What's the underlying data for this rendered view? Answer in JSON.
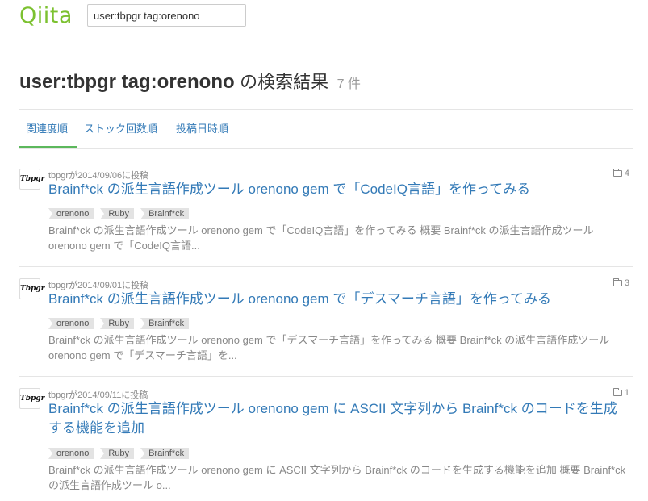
{
  "header": {
    "logo": "Qiita",
    "search_value": "user:tbpgr tag:orenono"
  },
  "results": {
    "query": "user:tbpgr tag:orenono",
    "suffix": "の検索結果",
    "count": "7 件"
  },
  "tabs": [
    {
      "label": "関連度順",
      "active": true
    },
    {
      "label": "ストック回数順",
      "active": false
    },
    {
      "label": "投稿日時順",
      "active": false
    }
  ],
  "items": [
    {
      "avatar": "Tbpgr",
      "meta": "tbpgrが2014/09/06に投稿",
      "stock": "4",
      "title": "Brainf*ck の派生言語作成ツール orenono gem で「CodeIQ言語」を作ってみる",
      "tags": [
        "orenono",
        "Ruby",
        "Brainf*ck"
      ],
      "snippet": "Brainf*ck の派生言語作成ツール orenono gem で「CodeIQ言語」を作ってみる 概要 Brainf*ck の派生言語作成ツール orenono gem で「CodeIQ言語..."
    },
    {
      "avatar": "Tbpgr",
      "meta": "tbpgrが2014/09/01に投稿",
      "stock": "3",
      "title": "Brainf*ck の派生言語作成ツール orenono gem で「デスマーチ言語」を作ってみる",
      "tags": [
        "orenono",
        "Ruby",
        "Brainf*ck"
      ],
      "snippet": "Brainf*ck の派生言語作成ツール orenono gem で「デスマーチ言語」を作ってみる 概要 Brainf*ck の派生言語作成ツール orenono gem で「デスマーチ言語」を..."
    },
    {
      "avatar": "Tbpgr",
      "meta": "tbpgrが2014/09/11に投稿",
      "stock": "1",
      "title": "Brainf*ck の派生言語作成ツール orenono gem に ASCII 文字列から Brainf*ck のコードを生成する機能を追加",
      "tags": [
        "orenono",
        "Ruby",
        "Brainf*ck"
      ],
      "snippet": "Brainf*ck の派生言語作成ツール orenono gem に ASCII 文字列から Brainf*ck のコードを生成する機能を追加 概要 Brainf*ck の派生言語作成ツール o..."
    }
  ]
}
